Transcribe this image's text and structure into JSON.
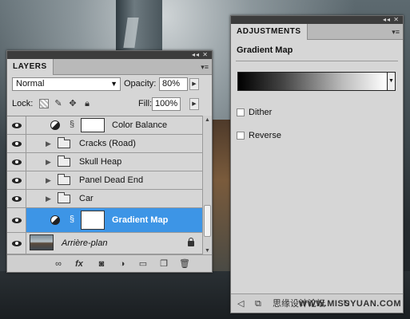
{
  "layers_panel": {
    "tab_label": "LAYERS",
    "blend_mode": "Normal",
    "opacity_label": "Opacity:",
    "opacity_value": "80%",
    "lock_label": "Lock:",
    "fill_label": "Fill:",
    "fill_value": "100%",
    "layers": [
      {
        "name": "Color Balance",
        "kind": "adjustment",
        "visible": true
      },
      {
        "name": "Cracks (Road)",
        "kind": "group",
        "visible": true
      },
      {
        "name": "Skull Heap",
        "kind": "group",
        "visible": true
      },
      {
        "name": "Panel Dead End",
        "kind": "group",
        "visible": true
      },
      {
        "name": "Car",
        "kind": "group",
        "visible": true
      },
      {
        "name": "Gradient Map",
        "kind": "adjustment",
        "visible": true,
        "selected": true
      },
      {
        "name": "Arrière-plan",
        "kind": "background",
        "visible": true,
        "locked": true
      }
    ],
    "footer_icons": [
      "link-icon",
      "fx-icon",
      "mask-icon",
      "adjustment-icon",
      "group-icon",
      "new-layer-icon",
      "trash-icon"
    ]
  },
  "adjustments_panel": {
    "tab_label": "ADJUSTMENTS",
    "title": "Gradient Map",
    "dither_label": "Dither",
    "dither_checked": false,
    "reverse_label": "Reverse",
    "reverse_checked": false,
    "footer_text": "思缘设计论坛",
    "watermark": "WWW.MISSYUAN.COM",
    "footer_icons": [
      "back-arrow-icon",
      "expand-icon",
      "clip-icon",
      "visibility-icon",
      "reset-icon"
    ]
  },
  "colors": {
    "selection": "#3d95e6",
    "panel_bg": "#d6d6d6",
    "panel_header": "#3c3c3c"
  }
}
